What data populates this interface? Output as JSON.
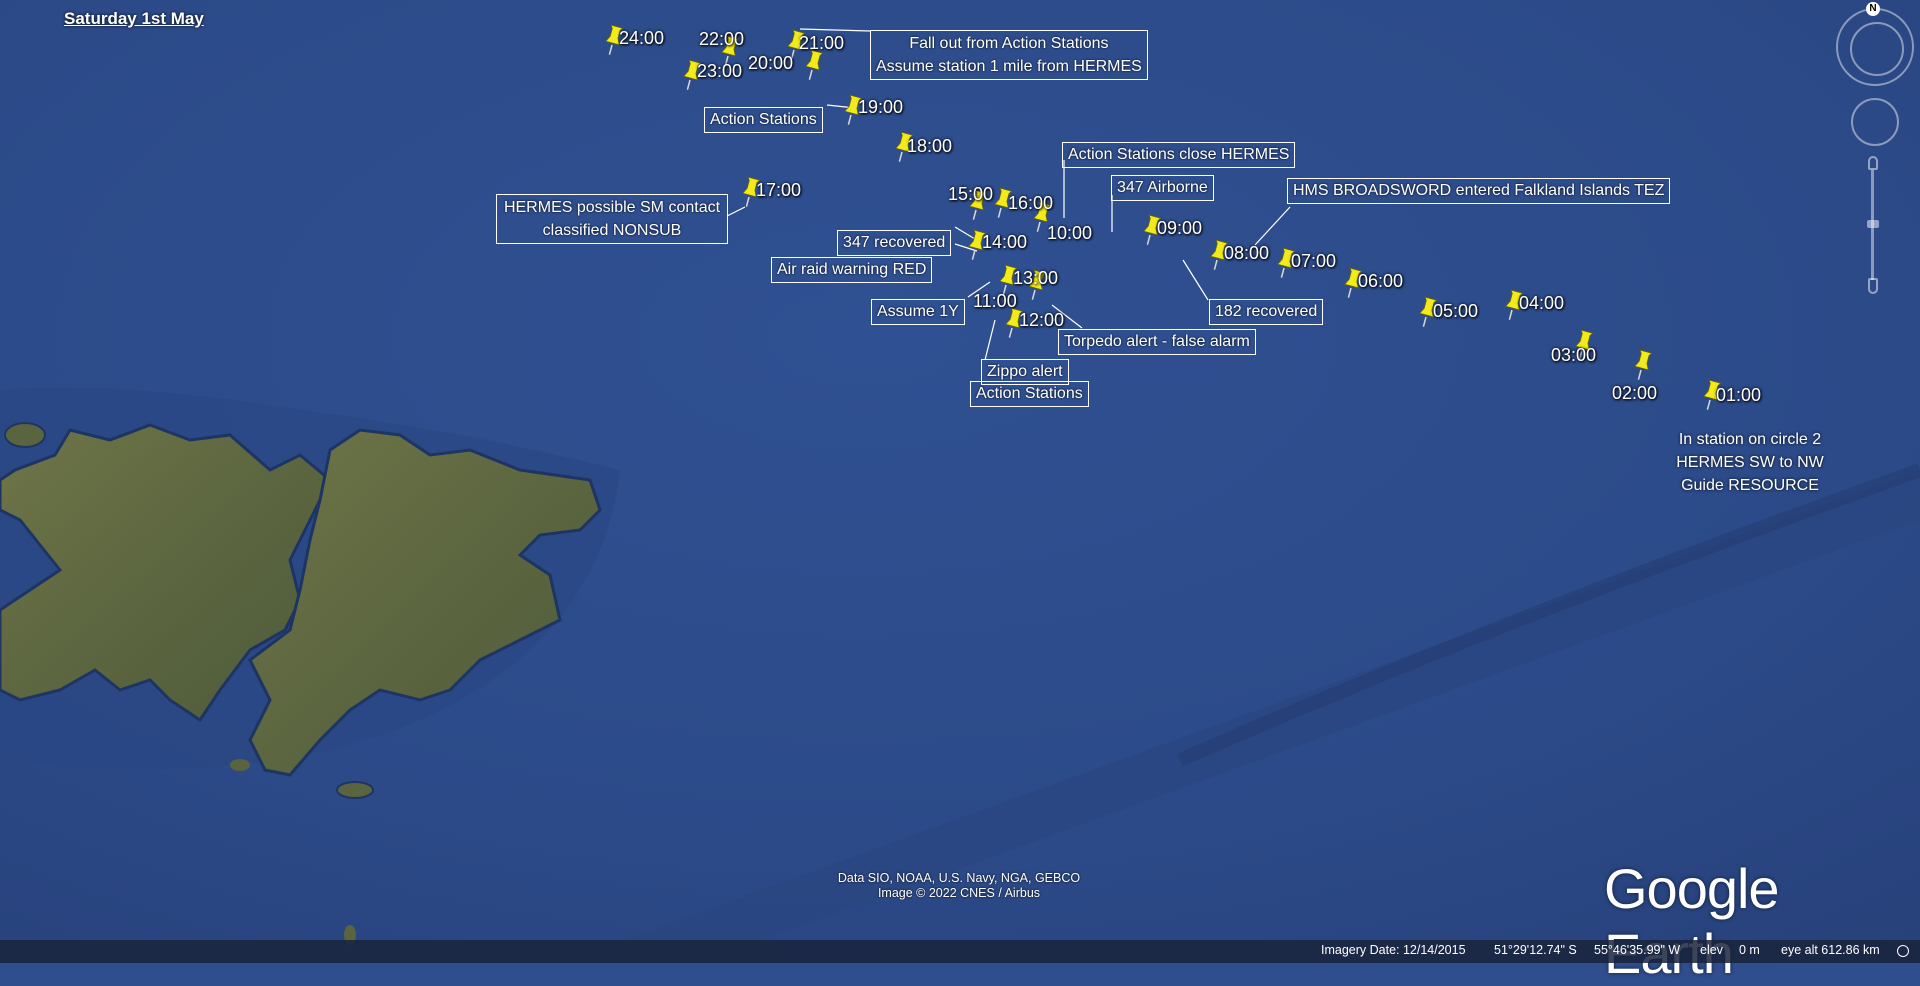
{
  "date_title": "Saturday 1st May",
  "pins": [
    {
      "time": "24:00"
    },
    {
      "time": "23:00"
    },
    {
      "time": "22:00"
    },
    {
      "time": "21:00"
    },
    {
      "time": "20:00"
    },
    {
      "time": "19:00"
    },
    {
      "time": "18:00"
    },
    {
      "time": "17:00"
    },
    {
      "time": "16:00"
    },
    {
      "time": "15:00"
    },
    {
      "time": "14:00"
    },
    {
      "time": "13:00"
    },
    {
      "time": "12:00"
    },
    {
      "time": "11:00"
    },
    {
      "time": "10:00"
    },
    {
      "time": "09:00"
    },
    {
      "time": "08:00"
    },
    {
      "time": "07:00"
    },
    {
      "time": "06:00"
    },
    {
      "time": "05:00"
    },
    {
      "time": "04:00"
    },
    {
      "time": "03:00"
    },
    {
      "time": "02:00"
    },
    {
      "time": "01:00"
    }
  ],
  "notes": {
    "fall_out": [
      "Fall out from Action Stations",
      "Assume station 1 mile from HERMES"
    ],
    "action_stations_19": "Action Stations",
    "action_stations_close": "Action Stations close HERMES",
    "hermes_contact": [
      "HERMES possible SM contact",
      "classified NONSUB"
    ],
    "airborne_347": "347 Airborne",
    "broadsword": "HMS BROADSWORD entered Falkland Islands TEZ",
    "recovered_347": "347 recovered",
    "air_raid": "Air raid warning RED",
    "assume_1y": "Assume 1Y",
    "recovered_182": "182 recovered",
    "torpedo": "Torpedo alert - false alarm",
    "zippo": "Zippo alert",
    "action_stations_12": "Action Stations",
    "in_station": [
      "In station on circle 2",
      "HERMES SW to NW",
      "Guide RESOURCE"
    ]
  },
  "attribution": [
    "Data SIO, NOAA, U.S. Navy, NGA, GEBCO",
    "Image © 2022 CNES / Airbus"
  ],
  "logo": "Google Earth",
  "compass_letter": "N",
  "status": {
    "imagery_date": "Imagery Date: 12/14/2015",
    "lat": "51°29'12.74\" S",
    "lon": "55°46'35.99\" W",
    "elev_label": "elev",
    "elev_value": "0 m",
    "eye_alt": "eye alt 612.86 km"
  },
  "colors": {
    "ocean": "#2f4e8e",
    "land": "#5e6a3c",
    "pin": "#f2ea1a"
  }
}
